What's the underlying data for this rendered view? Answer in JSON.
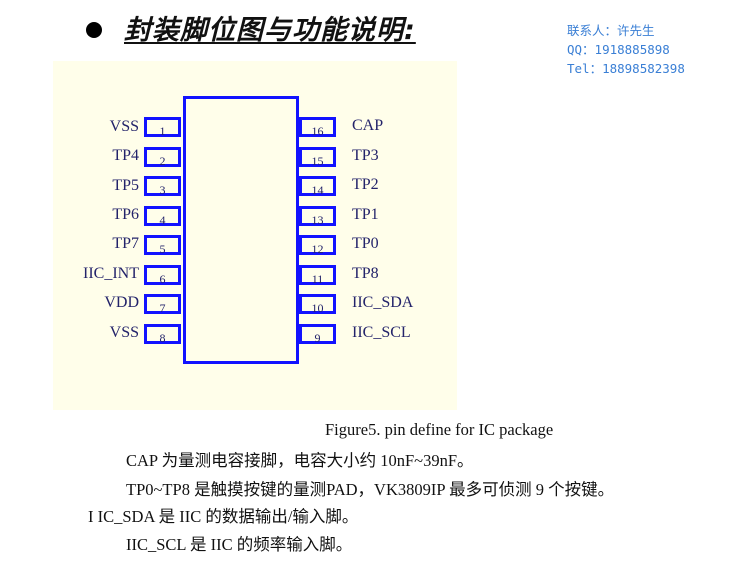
{
  "heading": {
    "bullet_icon": "filled-circle-bullet",
    "title": "封装脚位图与功能说明:"
  },
  "contact": {
    "name_line": "联系人：许先生",
    "qq_line": "QQ：1918885898",
    "tel_line": "Tel：18898582398",
    "color": "#3a7fd5"
  },
  "diagram": {
    "background": "#fffeea",
    "outline_color": "#1212ff",
    "left_pins": [
      {
        "number": "1",
        "name": "VSS"
      },
      {
        "number": "2",
        "name": "TP4"
      },
      {
        "number": "3",
        "name": "TP5"
      },
      {
        "number": "4",
        "name": "TP6"
      },
      {
        "number": "5",
        "name": "TP7"
      },
      {
        "number": "6",
        "name": "IIC_INT"
      },
      {
        "number": "7",
        "name": "VDD"
      },
      {
        "number": "8",
        "name": "VSS"
      }
    ],
    "right_pins": [
      {
        "number": "16",
        "name": "CAP"
      },
      {
        "number": "15",
        "name": "TP3"
      },
      {
        "number": "14",
        "name": "TP2"
      },
      {
        "number": "13",
        "name": "TP1"
      },
      {
        "number": "12",
        "name": "TP0"
      },
      {
        "number": "11",
        "name": "TP8"
      },
      {
        "number": "10",
        "name": "IIC_SDA"
      },
      {
        "number": "9",
        "name": "IIC_SCL"
      }
    ]
  },
  "caption": "Figure5. pin define for IC package",
  "paragraphs": [
    "CAP 为量测电容接脚，电容大小约 10nF~39nF。",
    "TP0~TP8 是触摸按键的量测PAD，VK3809IP  最多可侦测 9 个按键。",
    "I IC_SDA 是 IIC 的数据输出/输入脚。",
    "IIC_SCL 是 IIC 的频率输入脚。"
  ]
}
